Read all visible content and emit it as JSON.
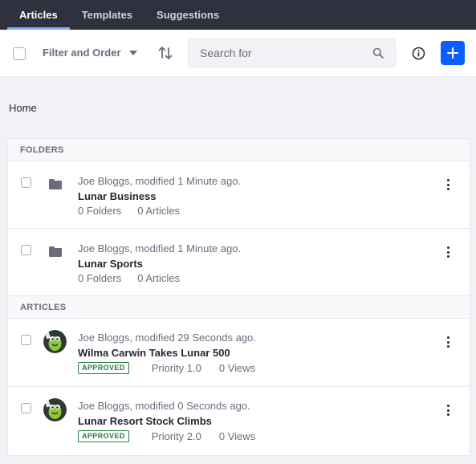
{
  "tabs": [
    {
      "label": "Articles",
      "active": true
    },
    {
      "label": "Templates",
      "active": false
    },
    {
      "label": "Suggestions",
      "active": false
    }
  ],
  "toolbar": {
    "filter_label": "Filter and Order",
    "search_placeholder": "Search for",
    "sort_icon": "sort-arrows-icon",
    "info_icon": "info-icon",
    "add_icon": "plus-icon"
  },
  "breadcrumb": "Home",
  "folders": {
    "header": "FOLDERS",
    "items": [
      {
        "meta": "Joe Bloggs, modified 1 Minute ago.",
        "title": "Lunar Business",
        "folders": "0 Folders",
        "articles": "0 Articles"
      },
      {
        "meta": "Joe Bloggs, modified 1 Minute ago.",
        "title": "Lunar Sports",
        "folders": "0 Folders",
        "articles": "0 Articles"
      }
    ]
  },
  "articles": {
    "header": "ARTICLES",
    "items": [
      {
        "meta": "Joe Bloggs, modified 29 Seconds ago.",
        "title": "Wilma Carwin Takes Lunar 500",
        "status": "APPROVED",
        "priority": "Priority 1.0",
        "views": "0 Views"
      },
      {
        "meta": "Joe Bloggs, modified 0 Seconds ago.",
        "title": "Lunar Resort Stock Climbs",
        "status": "APPROVED",
        "priority": "Priority 2.0",
        "views": "0 Views"
      }
    ]
  },
  "colors": {
    "nav_bg": "#30313f",
    "accent": "#0b5fff",
    "approved": "#287d3c",
    "tab_underline": "#80acff"
  }
}
